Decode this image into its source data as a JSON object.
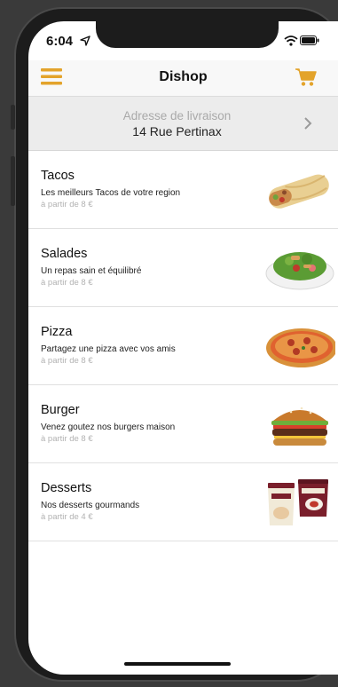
{
  "status": {
    "time": "6:04"
  },
  "navbar": {
    "title": "Dishop"
  },
  "address": {
    "label": "Adresse de livraison",
    "value": "14 Rue Pertinax"
  },
  "categories": [
    {
      "title": "Tacos",
      "description": "Les meilleurs Tacos de votre region",
      "price": "à partir de 8 €",
      "image": "tacos-image"
    },
    {
      "title": "Salades",
      "description": "Un repas sain et équilibré",
      "price": "à partir de 8 €",
      "image": "salad-image"
    },
    {
      "title": "Pizza",
      "description": "Partagez une pizza avec vos amis",
      "price": "à partir de 8 €",
      "image": "pizza-image"
    },
    {
      "title": "Burger",
      "description": "Venez goutez nos burgers maison",
      "price": "à partir de 8 €",
      "image": "burger-image"
    },
    {
      "title": "Desserts",
      "description": "Nos desserts gourmands",
      "price": "à partir de 4 €",
      "image": "desserts-image"
    }
  ],
  "colors": {
    "accent": "#e3a32b",
    "background": "#3a3a3a"
  }
}
